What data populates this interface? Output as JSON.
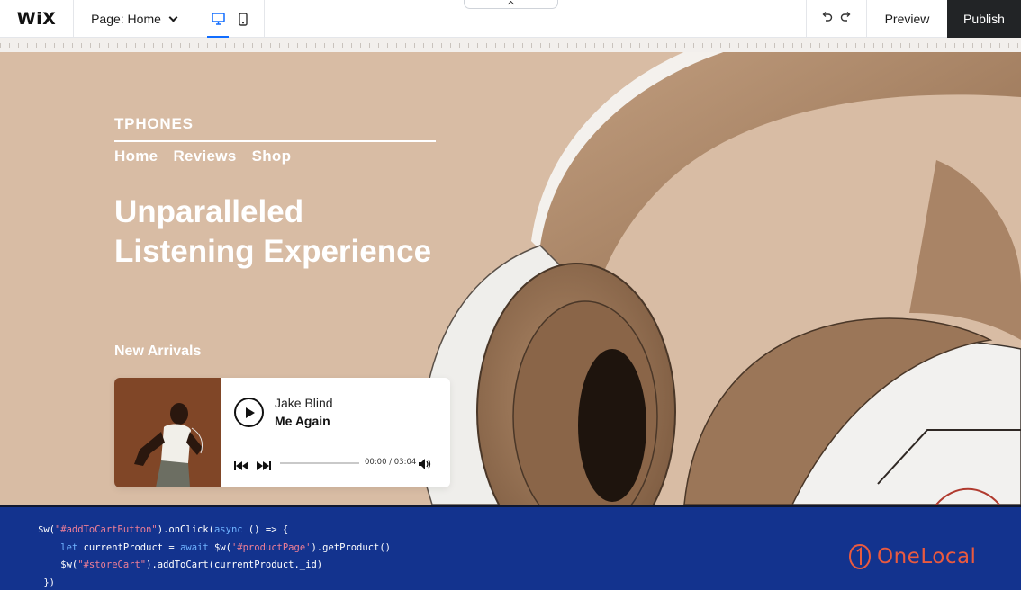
{
  "editor": {
    "logo": "WiX",
    "page_selector": "Page: Home",
    "preview_label": "Preview",
    "publish_label": "Publish"
  },
  "site": {
    "brand": "TPHONES",
    "nav": [
      "Home",
      "Reviews",
      "Shop"
    ],
    "headline_line1": "Unparalleled",
    "headline_line2": "Listening Experience",
    "section_label": "New Arrivals"
  },
  "player": {
    "artist": "Jake Blind",
    "track": "Me Again",
    "time": "00:00 / 03:04",
    "progress": 0
  },
  "code": {
    "line1": {
      "a": "$w(",
      "b": "\"#addToCartButton\"",
      "c": ").onClick(",
      "d": "async",
      "e": " () => {"
    },
    "line2": {
      "a": "    ",
      "b": "let",
      "c": " currentProduct = ",
      "d": "await",
      "e": " $w(",
      "f": "'#productPage'",
      "g": ").getProduct()"
    },
    "line3": {
      "a": "    $w(",
      "b": "\"#storeCart\"",
      "c": ").addToCart(currentProduct._id)"
    },
    "line4": " })"
  },
  "watermark": {
    "text": "OneLocal"
  },
  "colors": {
    "hero_bg": "#d8bca4",
    "publish_bg": "#222426",
    "accent_blue": "#116dff",
    "code_bg": "#13338e",
    "onelocal": "#ea5a3f"
  }
}
